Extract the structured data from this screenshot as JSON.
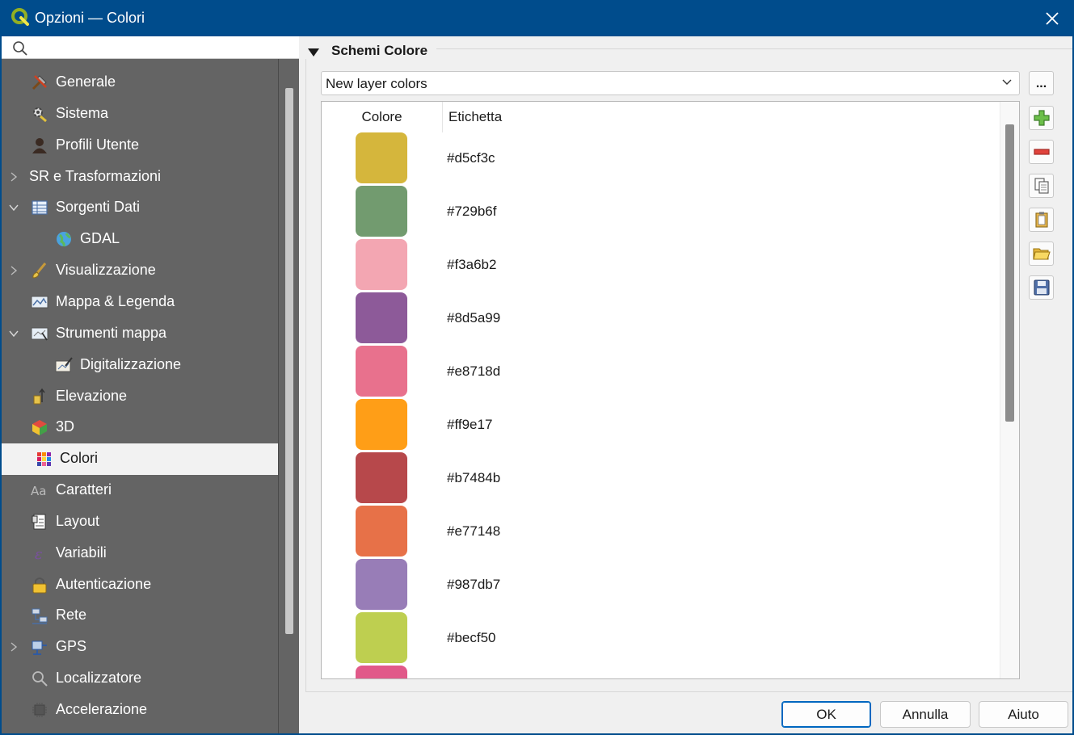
{
  "window": {
    "title": "Opzioni — Colori"
  },
  "search": {
    "placeholder": "",
    "value": ""
  },
  "nav": {
    "items": [
      {
        "label": "Generale",
        "icon": "tools-icon",
        "expander": "none",
        "indent": 0
      },
      {
        "label": "Sistema",
        "icon": "system-gear-icon",
        "expander": "none",
        "indent": 0
      },
      {
        "label": "Profili Utente",
        "icon": "user-profile-icon",
        "expander": "none",
        "indent": 0
      },
      {
        "label": "SR e Trasformazioni",
        "icon": "",
        "expander": "collapsed",
        "indent": 0
      },
      {
        "label": "Sorgenti Dati",
        "icon": "data-sources-icon",
        "expander": "expanded",
        "indent": 0
      },
      {
        "label": "GDAL",
        "icon": "globe-icon",
        "expander": "none",
        "indent": 1
      },
      {
        "label": "Visualizzazione",
        "icon": "paintbrush-icon",
        "expander": "collapsed",
        "indent": 0
      },
      {
        "label": "Mappa & Legenda",
        "icon": "map-legend-icon",
        "expander": "none",
        "indent": 0
      },
      {
        "label": "Strumenti mappa",
        "icon": "map-tools-icon",
        "expander": "expanded",
        "indent": 0
      },
      {
        "label": "Digitalizzazione",
        "icon": "digitizing-icon",
        "expander": "none",
        "indent": 1
      },
      {
        "label": "Elevazione",
        "icon": "elevation-icon",
        "expander": "none",
        "indent": 0
      },
      {
        "label": "3D",
        "icon": "cube-3d-icon",
        "expander": "none",
        "indent": 0
      },
      {
        "label": "Colori",
        "icon": "color-palette-icon",
        "expander": "none",
        "indent": 0,
        "selected": true
      },
      {
        "label": "Caratteri",
        "icon": "fonts-icon",
        "expander": "none",
        "indent": 0
      },
      {
        "label": "Layout",
        "icon": "layout-icon",
        "expander": "none",
        "indent": 0
      },
      {
        "label": "Variabili",
        "icon": "variables-icon",
        "expander": "none",
        "indent": 0
      },
      {
        "label": "Autenticazione",
        "icon": "padlock-icon",
        "expander": "none",
        "indent": 0
      },
      {
        "label": "Rete",
        "icon": "network-icon",
        "expander": "none",
        "indent": 0
      },
      {
        "label": "GPS",
        "icon": "gps-icon",
        "expander": "collapsed",
        "indent": 0
      },
      {
        "label": "Localizzatore",
        "icon": "magnifier-icon",
        "expander": "none",
        "indent": 0
      },
      {
        "label": "Accelerazione",
        "icon": "chip-icon",
        "expander": "none",
        "indent": 0
      }
    ]
  },
  "schemes": {
    "group_title": "Schemi Colore",
    "selected_scheme": "New layer colors",
    "more_button": "...",
    "columns": {
      "color": "Colore",
      "label": "Etichetta"
    },
    "colors": [
      {
        "color": "#d5b63c",
        "label": "#d5cf3c"
      },
      {
        "color": "#729b6f",
        "label": "#729b6f"
      },
      {
        "color": "#f3a6b2",
        "label": "#f3a6b2"
      },
      {
        "color": "#8d5a99",
        "label": "#8d5a99"
      },
      {
        "color": "#e8718d",
        "label": "#e8718d"
      },
      {
        "color": "#ff9e17",
        "label": "#ff9e17"
      },
      {
        "color": "#b7484b",
        "label": "#b7484b"
      },
      {
        "color": "#e77148",
        "label": "#e77148"
      },
      {
        "color": "#987db7",
        "label": "#987db7"
      },
      {
        "color": "#becf50",
        "label": "#becf50"
      },
      {
        "color": "#e15989",
        "label": ""
      }
    ],
    "side_buttons": [
      "add-color-icon",
      "remove-color-icon",
      "copy-colors-icon",
      "paste-colors-icon",
      "import-scheme-icon",
      "export-scheme-icon"
    ]
  },
  "buttons": {
    "ok": "OK",
    "cancel": "Annulla",
    "help": "Aiuto"
  },
  "colors": {
    "titlebar": "#004c8c",
    "nav_bg": "#646464",
    "selected_bg": "#f2f2f2",
    "primary_border": "#0067c0"
  }
}
